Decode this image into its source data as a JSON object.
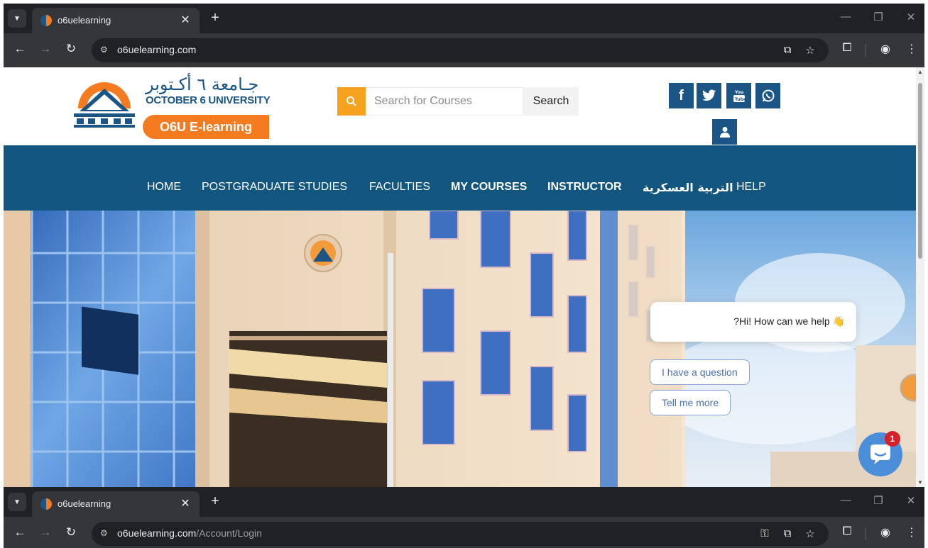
{
  "browser_top": {
    "tab_title": "o6uelearning",
    "url_host": "o6uelearning.com",
    "url_path": ""
  },
  "browser_bottom": {
    "tab_title": "o6uelearning",
    "url_host": "o6uelearning.com",
    "url_path": "/Account/Login"
  },
  "header": {
    "logo_arabic": "جـامعة ٦ أكـتوبر",
    "logo_english": "OCTOBER 6 UNIVERSITY",
    "logo_badge": "O6U E-learning",
    "search_placeholder": "Search for Courses",
    "search_button": "Search",
    "social": {
      "facebook": "f",
      "twitter": "twitter-icon",
      "youtube": "youtube-icon",
      "whatsapp": "whatsapp-icon",
      "user": "user-icon"
    }
  },
  "nav": {
    "items": [
      "HOME",
      "POSTGRADUATE STUDIES",
      "FACULTIES",
      "MY COURSES",
      "INSTRUCTOR",
      "التربية العسكرية",
      "HELP"
    ]
  },
  "chat": {
    "greeting": "?Hi! How can we help 👋",
    "choices": [
      "I have a question",
      "Tell me more"
    ],
    "unread_count": "1"
  },
  "colors": {
    "brand_blue": "#12557f",
    "brand_orange": "#f47b20",
    "search_orange": "#f6a21e",
    "chrome_dark": "#35363a"
  }
}
